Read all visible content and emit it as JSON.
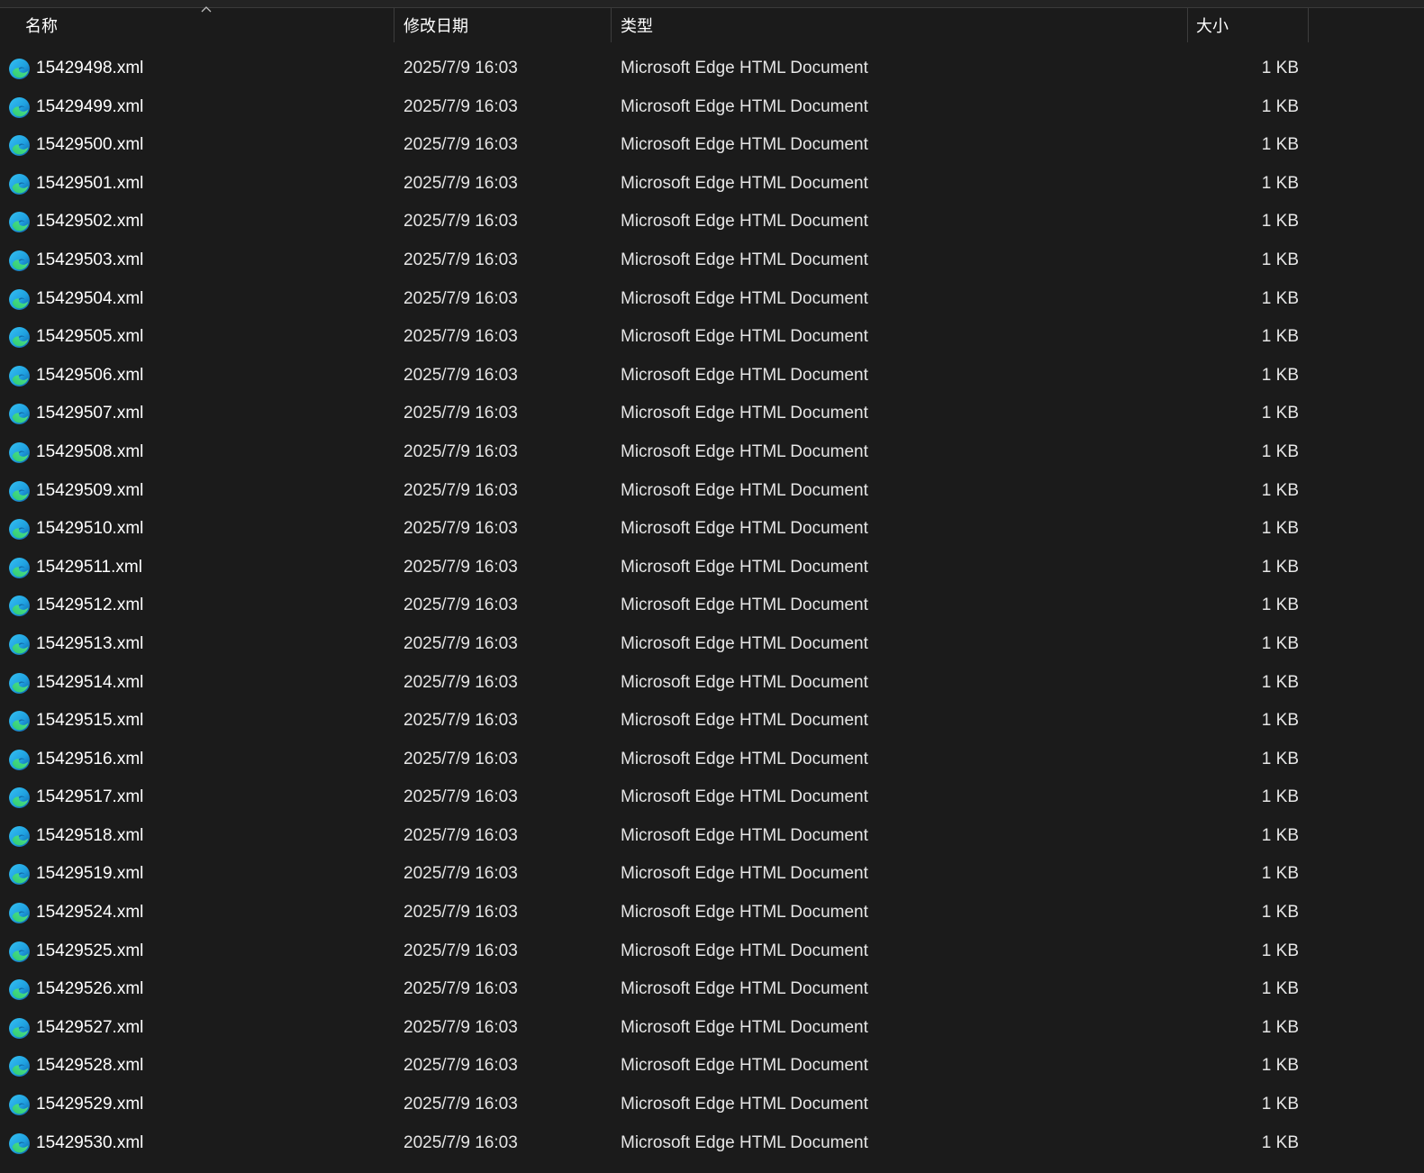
{
  "columns": {
    "name": "名称",
    "date": "修改日期",
    "type": "类型",
    "size": "大小"
  },
  "sort": {
    "column": "name",
    "direction": "ascending",
    "icon": "chevron-up-icon"
  },
  "file_icon": "edge-icon",
  "colors": {
    "background": "#1b1b1b",
    "text": "#ffffff",
    "separator": "#3d3d3d"
  },
  "files": [
    {
      "name": "15429498.xml",
      "date": "2025/7/9 16:03",
      "type": "Microsoft Edge HTML Document",
      "size": "1 KB"
    },
    {
      "name": "15429499.xml",
      "date": "2025/7/9 16:03",
      "type": "Microsoft Edge HTML Document",
      "size": "1 KB"
    },
    {
      "name": "15429500.xml",
      "date": "2025/7/9 16:03",
      "type": "Microsoft Edge HTML Document",
      "size": "1 KB"
    },
    {
      "name": "15429501.xml",
      "date": "2025/7/9 16:03",
      "type": "Microsoft Edge HTML Document",
      "size": "1 KB"
    },
    {
      "name": "15429502.xml",
      "date": "2025/7/9 16:03",
      "type": "Microsoft Edge HTML Document",
      "size": "1 KB"
    },
    {
      "name": "15429503.xml",
      "date": "2025/7/9 16:03",
      "type": "Microsoft Edge HTML Document",
      "size": "1 KB"
    },
    {
      "name": "15429504.xml",
      "date": "2025/7/9 16:03",
      "type": "Microsoft Edge HTML Document",
      "size": "1 KB"
    },
    {
      "name": "15429505.xml",
      "date": "2025/7/9 16:03",
      "type": "Microsoft Edge HTML Document",
      "size": "1 KB"
    },
    {
      "name": "15429506.xml",
      "date": "2025/7/9 16:03",
      "type": "Microsoft Edge HTML Document",
      "size": "1 KB"
    },
    {
      "name": "15429507.xml",
      "date": "2025/7/9 16:03",
      "type": "Microsoft Edge HTML Document",
      "size": "1 KB"
    },
    {
      "name": "15429508.xml",
      "date": "2025/7/9 16:03",
      "type": "Microsoft Edge HTML Document",
      "size": "1 KB"
    },
    {
      "name": "15429509.xml",
      "date": "2025/7/9 16:03",
      "type": "Microsoft Edge HTML Document",
      "size": "1 KB"
    },
    {
      "name": "15429510.xml",
      "date": "2025/7/9 16:03",
      "type": "Microsoft Edge HTML Document",
      "size": "1 KB"
    },
    {
      "name": "15429511.xml",
      "date": "2025/7/9 16:03",
      "type": "Microsoft Edge HTML Document",
      "size": "1 KB"
    },
    {
      "name": "15429512.xml",
      "date": "2025/7/9 16:03",
      "type": "Microsoft Edge HTML Document",
      "size": "1 KB"
    },
    {
      "name": "15429513.xml",
      "date": "2025/7/9 16:03",
      "type": "Microsoft Edge HTML Document",
      "size": "1 KB"
    },
    {
      "name": "15429514.xml",
      "date": "2025/7/9 16:03",
      "type": "Microsoft Edge HTML Document",
      "size": "1 KB"
    },
    {
      "name": "15429515.xml",
      "date": "2025/7/9 16:03",
      "type": "Microsoft Edge HTML Document",
      "size": "1 KB"
    },
    {
      "name": "15429516.xml",
      "date": "2025/7/9 16:03",
      "type": "Microsoft Edge HTML Document",
      "size": "1 KB"
    },
    {
      "name": "15429517.xml",
      "date": "2025/7/9 16:03",
      "type": "Microsoft Edge HTML Document",
      "size": "1 KB"
    },
    {
      "name": "15429518.xml",
      "date": "2025/7/9 16:03",
      "type": "Microsoft Edge HTML Document",
      "size": "1 KB"
    },
    {
      "name": "15429519.xml",
      "date": "2025/7/9 16:03",
      "type": "Microsoft Edge HTML Document",
      "size": "1 KB"
    },
    {
      "name": "15429524.xml",
      "date": "2025/7/9 16:03",
      "type": "Microsoft Edge HTML Document",
      "size": "1 KB"
    },
    {
      "name": "15429525.xml",
      "date": "2025/7/9 16:03",
      "type": "Microsoft Edge HTML Document",
      "size": "1 KB"
    },
    {
      "name": "15429526.xml",
      "date": "2025/7/9 16:03",
      "type": "Microsoft Edge HTML Document",
      "size": "1 KB"
    },
    {
      "name": "15429527.xml",
      "date": "2025/7/9 16:03",
      "type": "Microsoft Edge HTML Document",
      "size": "1 KB"
    },
    {
      "name": "15429528.xml",
      "date": "2025/7/9 16:03",
      "type": "Microsoft Edge HTML Document",
      "size": "1 KB"
    },
    {
      "name": "15429529.xml",
      "date": "2025/7/9 16:03",
      "type": "Microsoft Edge HTML Document",
      "size": "1 KB"
    },
    {
      "name": "15429530.xml",
      "date": "2025/7/9 16:03",
      "type": "Microsoft Edge HTML Document",
      "size": "1 KB"
    }
  ]
}
